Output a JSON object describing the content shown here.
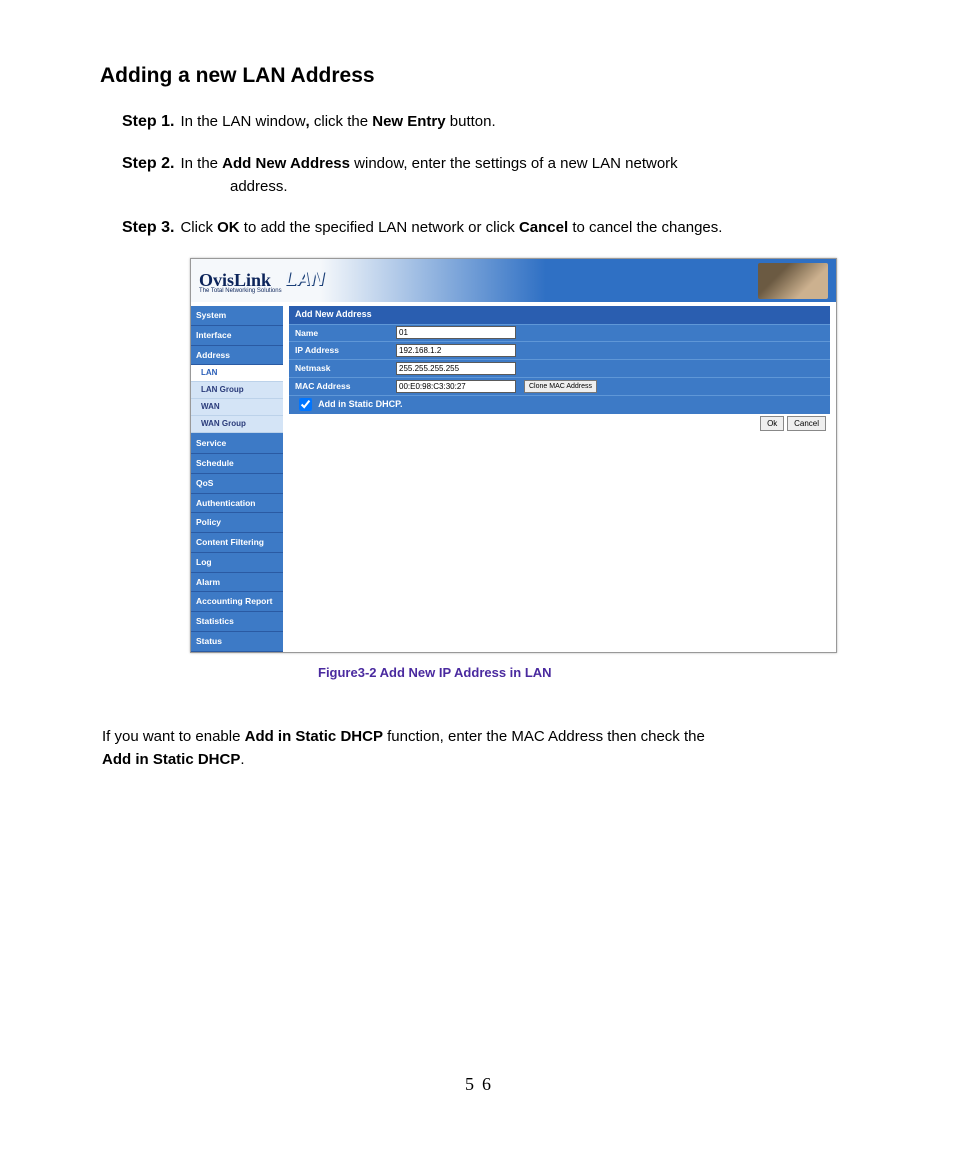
{
  "title": "Adding a new LAN Address",
  "steps": {
    "1": {
      "label": "Step 1.",
      "text_a": "In the LAN window",
      "text_b": " click the ",
      "bold": "New Entry",
      "text_c": " button."
    },
    "2": {
      "label": "Step 2.",
      "text_a": "In the ",
      "bold": "Add New Address",
      "text_b": " window, enter the settings of a new LAN network",
      "cont": "address."
    },
    "3": {
      "label": "Step 3.",
      "text_a": "Click ",
      "bold1": "OK",
      "text_b": " to add the specified LAN network or click ",
      "bold2": "Cancel",
      "text_c": " to cancel the changes."
    }
  },
  "screenshot": {
    "logo": "OvisLink",
    "logo_sub": "The Total Networking Solutions",
    "header_title": "LAN",
    "nav": {
      "items": [
        "System",
        "Interface",
        "Address",
        "Service",
        "Schedule",
        "QoS",
        "Authentication",
        "Policy",
        "Content Filtering",
        "Log",
        "Alarm",
        "Accounting Report",
        "Statistics",
        "Status"
      ],
      "sub": [
        "LAN",
        "LAN Group",
        "WAN",
        "WAN Group"
      ],
      "sub_selected": "LAN"
    },
    "form": {
      "title": "Add New Address",
      "rows": {
        "name": {
          "label": "Name",
          "value": "01"
        },
        "ip": {
          "label": "IP Address",
          "value": "192.168.1.2"
        },
        "netmask": {
          "label": "Netmask",
          "value": "255.255.255.255"
        },
        "mac": {
          "label": "MAC Address",
          "value": "00:E0:98:C3:30:27"
        }
      },
      "clone_btn": "Clone MAC Address",
      "checkbox_label": "Add in Static DHCP.",
      "ok": "Ok",
      "cancel": "Cancel"
    }
  },
  "caption": "Figure3-2 Add New IP Address in LAN",
  "closing": {
    "a": "If you want to enable ",
    "b1": "Add in Static DHCP",
    "c": " function, enter the MAC Address then check the ",
    "b2": "Add in Static DHCP",
    "d": "."
  },
  "page_number": "56"
}
